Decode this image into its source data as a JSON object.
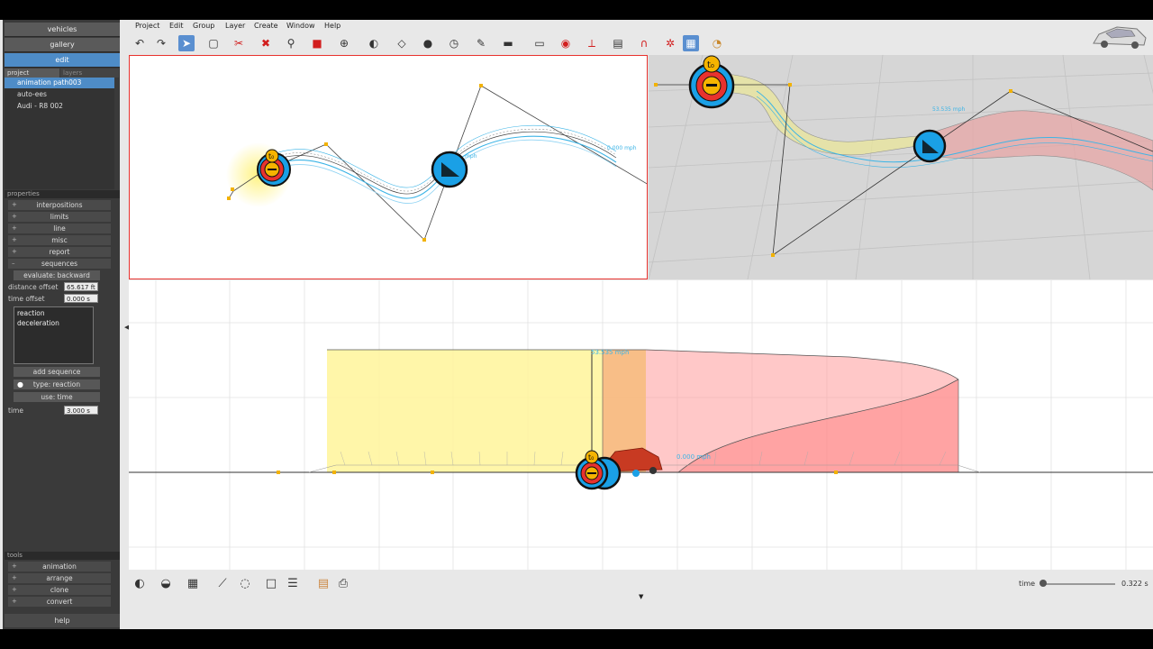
{
  "nav": {
    "vehicles": "vehicles",
    "gallery": "gallery",
    "edit": "edit"
  },
  "panel_tabs": {
    "project": "project",
    "layers": "layers"
  },
  "project_items": [
    "animation path003",
    "auto-ees",
    "Audi - R8 002"
  ],
  "properties": {
    "header": "properties",
    "sections": [
      "interpositions",
      "limits",
      "line",
      "misc",
      "report",
      "sequences"
    ],
    "evaluate_label": "evaluate: backward",
    "distance_offset_label": "distance offset",
    "distance_offset_value": "65.617 ft",
    "time_offset_label": "time offset",
    "time_offset_value": "0.000 s",
    "sequences": [
      "reaction",
      "deceleration"
    ],
    "add_sequence_label": "add sequence",
    "type_label": "type: reaction",
    "use_label": "use: time",
    "time_label": "time",
    "time_value": "3.000 s"
  },
  "tools": {
    "header": "tools",
    "items": [
      "animation",
      "arrange",
      "clone",
      "convert"
    ],
    "help_label": "help"
  },
  "menu": [
    "Project",
    "Edit",
    "Group",
    "Layer",
    "Create",
    "Window",
    "Help"
  ],
  "icons": [
    "undo-icon",
    "redo-icon",
    "select-arrow-icon",
    "rectangle-select-icon",
    "scissors-icon",
    "delete-x-icon",
    "zoom-icon",
    "red-cube-icon",
    "move-crosshair-icon",
    "measure-circle-icon",
    "plane-icon",
    "sphere-icon",
    "clock-icon",
    "wrench-icon",
    "tape-icon",
    "camera-icon",
    "target-icon",
    "axes-icon",
    "film-icon",
    "magnet-icon",
    "gears-icon",
    "grid-icon",
    "help-icon"
  ],
  "viewport_labels": {
    "top_speed_end": "0.000 mph",
    "top_speed_mid": "mph",
    "persp_speed": "53.535 mph",
    "side_speed_top": "53.535 mph",
    "side_speed_end": "0.000 mph"
  },
  "marker_glyph": "t₀",
  "timeline": {
    "label": "time",
    "value": "0.322 s",
    "fraction": 0.02
  },
  "colors": {
    "accent": "#4e8cc7",
    "selection_border": "#e8322e",
    "path": "#3cb4e6",
    "reaction_zone": "#fff59a",
    "braking_zone": "#ff9b9b",
    "marker_blue": "#1aa0e6"
  }
}
